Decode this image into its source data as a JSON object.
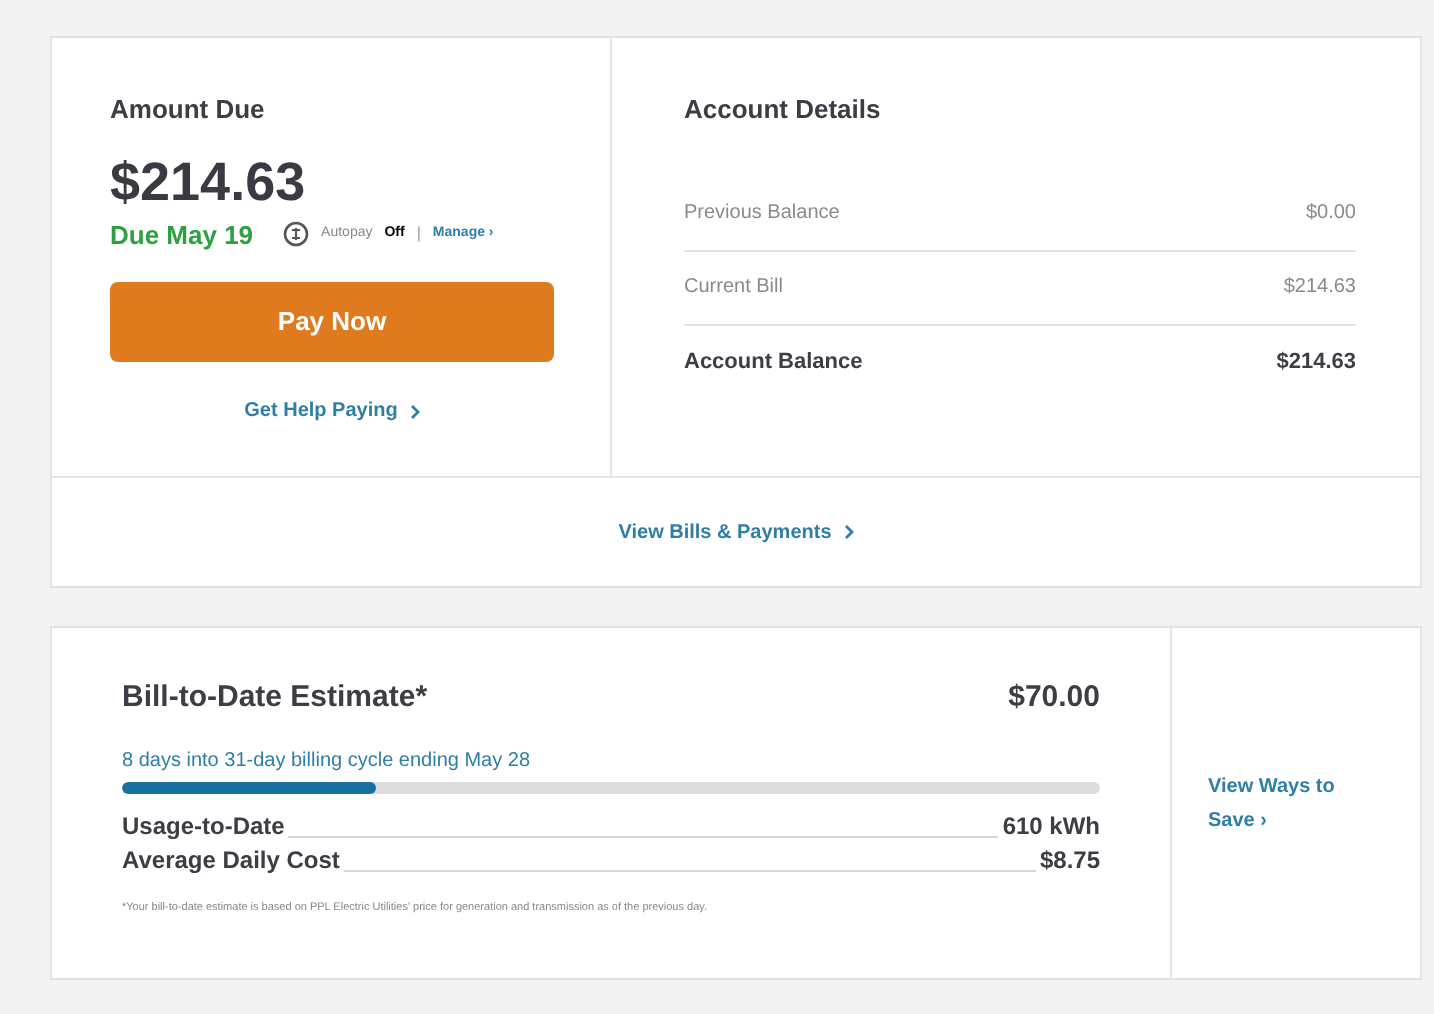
{
  "amount_due": {
    "title": "Amount Due",
    "amount": "$214.63",
    "due": "Due May 19",
    "autopay": {
      "label": "Autopay",
      "state": "Off",
      "separator": "|",
      "link": "Manage ›"
    },
    "pay_button": "Pay Now",
    "help_link": "Get Help Paying"
  },
  "account_details": {
    "title": "Account Details",
    "rows": [
      {
        "label": "Previous Balance",
        "value": "$0.00",
        "kind": "normal"
      },
      {
        "label": "Current Bill",
        "value": "$214.63",
        "kind": "normal"
      },
      {
        "label": "Account Balance",
        "value": "$214.63",
        "kind": "total"
      }
    ]
  },
  "bills_link": "View Bills & Payments",
  "estimate": {
    "title": "Bill-to-Date Estimate*",
    "amount": "$70.00",
    "cycle": "8 days into 31-day billing cycle ending May 28",
    "level": 0.26,
    "stats": [
      {
        "label": "Usage-to-Date",
        "value": "610 kWh"
      },
      {
        "label": "Average Daily Cost",
        "value": "$8.75"
      }
    ],
    "footnote": "*Your bill-to-date estimate is based on PPL Electric Utilities' price for generation and transmission as of the previous day.",
    "save_link": "View Ways to Save ›"
  }
}
